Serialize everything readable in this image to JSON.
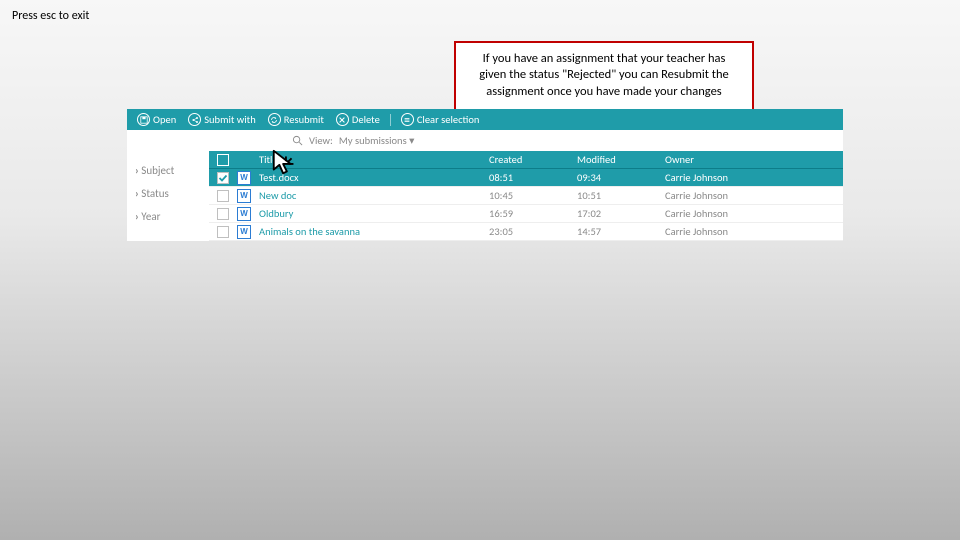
{
  "esc_text": "Press esc to exit",
  "callout": "If you have an assignment that your teacher has given the status \"Rejected\" you can Resubmit the assignment once you have made your changes",
  "toolbar": {
    "open": "Open",
    "submit": "Submit with",
    "resubmit": "Resubmit",
    "delete": "Delete",
    "clear": "Clear selection"
  },
  "view_label": "View:",
  "view_value": "My submissions",
  "sidebar": [
    "Subject",
    "Status",
    "Year"
  ],
  "headers": {
    "title": "Title",
    "created": "Created",
    "modified": "Modified",
    "owner": "Owner"
  },
  "rows": [
    {
      "selected": true,
      "file": "W",
      "title": "Test.docx",
      "created": "08:51",
      "modified": "09:34",
      "owner": "Carrie Johnson"
    },
    {
      "selected": false,
      "file": "W",
      "title": "New doc",
      "created": "10:45",
      "modified": "10:51",
      "owner": "Carrie Johnson"
    },
    {
      "selected": false,
      "file": "W",
      "title": "Oldbury",
      "created": "16:59",
      "modified": "17:02",
      "owner": "Carrie Johnson"
    },
    {
      "selected": false,
      "file": "W",
      "title": "Animals on the savanna",
      "created": "23:05",
      "modified": "14:57",
      "owner": "Carrie Johnson"
    }
  ]
}
